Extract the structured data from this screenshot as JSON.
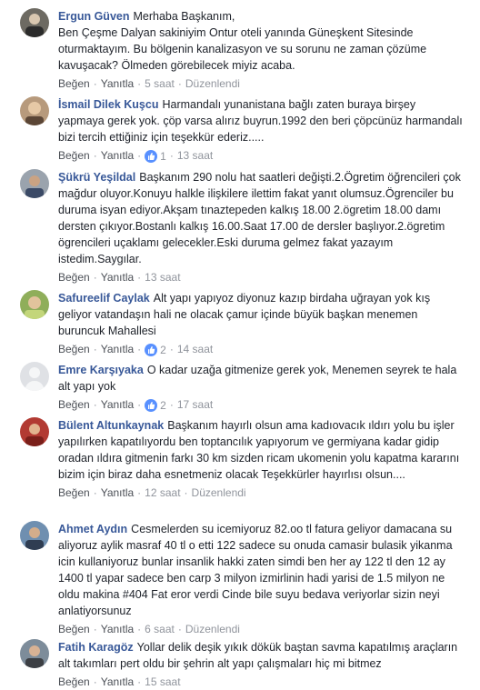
{
  "actions": {
    "like": "Beğen",
    "reply": "Yanıtla",
    "edited": "Düzenlendi",
    "separator": "·"
  },
  "colors": {
    "author": "#385898",
    "like_blue": "#5890ff",
    "meta": "#90949c"
  },
  "comments": [
    {
      "author": "Ergun Güven",
      "text": "Merhaba Başkanım,\nBen Çeşme Dalyan sakiniyim Ontur oteli yanında Güneşkent Sitesinde oturmaktayım. Bu bölgenin kanalizasyon ve su sorunu ne zaman çözüme kavuşacak? Ölmeden görebilecek miyiz acaba.",
      "time": "5 saat",
      "edited": "Düzenlendi",
      "likes": ""
    },
    {
      "author": "İsmail Dilek Kuşcu",
      "text": "Harmandalı yunanistana bağlı zaten buraya birşey yapmaya gerek yok. çöp varsa alırız buyrun.1992 den beri çöpcünüz harmandalı bizi tercih ettiğiniz için teşekkür ederiz.....",
      "time": "13 saat",
      "edited": "",
      "likes": "1"
    },
    {
      "author": "Şükrü Yeşildal",
      "text": "Başkanım 290 nolu hat saatleri değişti.2.Ögretim öğrencileri çok mağdur oluyor.Konuyu halkle ilişkilere ilettim fakat yanıt olumsuz.Ögrenciler bu duruma isyan ediyor.Akşam tınaztepeden kalkış 18.00 2.ögretim 18.00 damı dersten çıkıyor.Bostanlı kalkış 16.00.Saat 17.00 de dersler başlıyor.2.ögretim ögrencileri uçaklamı gelecekler.Eski duruma gelmez fakat yazayım istedim.Saygılar.",
      "time": "13 saat",
      "edited": "",
      "likes": ""
    },
    {
      "author": "Safureelif Caylak",
      "text": "Alt yapı yapıyoz diyonuz kazıp birdaha uğrayan yok kış geliyor vatandaşın hali ne olacak çamur içinde büyük başkan menemen buruncuk Mahallesi",
      "time": "14 saat",
      "edited": "",
      "likes": "2"
    },
    {
      "author": "Emre Karşıyaka",
      "text": "O kadar uzağa gitmenize gerek yok, Menemen seyrek te hala alt yapı yok",
      "time": "17 saat",
      "edited": "",
      "likes": "2"
    },
    {
      "author": "Bülent Altunkaynak",
      "text": "Başkanım hayırlı olsun ama kadıovacık ıldırı yolu bu işler yapılırken kapatılıyordu ben toptancılık yapıyorum ve germiyana kadar gidip oradan ıldıra gitmenin farkı 30 km sizden ricam ukomenin yolu kapatma kararını bizim için biraz daha esnetmeniz olacak Teşekkürler hayırlısı olsun....",
      "time": "12 saat",
      "edited": "Düzenlendi",
      "likes": ""
    },
    {
      "author": "Ahmet Aydın",
      "text": "Cesmelerden su icemiyoruz 82.oo tl fatura geliyor damacana su aliyoruz aylik masraf 40 tl o etti 122 sadece su onuda camasir bulasik yikanma icin kullaniyoruz bunlar insanlik hakki zaten simdi ben her ay 122 tl den 12 ay 1400 tl yapar sadece ben carp 3 milyon izmirlinin hadi yarisi de 1.5 milyon ne oldu makina #404 Fat eror verdi Cinde bile suyu bedava veriyorlar sizin neyi anlatiyorsunuz",
      "time": "6 saat",
      "edited": "Düzenlendi",
      "likes": ""
    },
    {
      "author": "Fatih Karagöz",
      "text": "Yollar delik deşik yıkık dökük baştan savma kapatılmış araçların alt takımları pert oldu bir şehrin alt yapı çalışmaları hiç mi bitmez",
      "time": "15 saat",
      "edited": "",
      "likes": ""
    }
  ]
}
